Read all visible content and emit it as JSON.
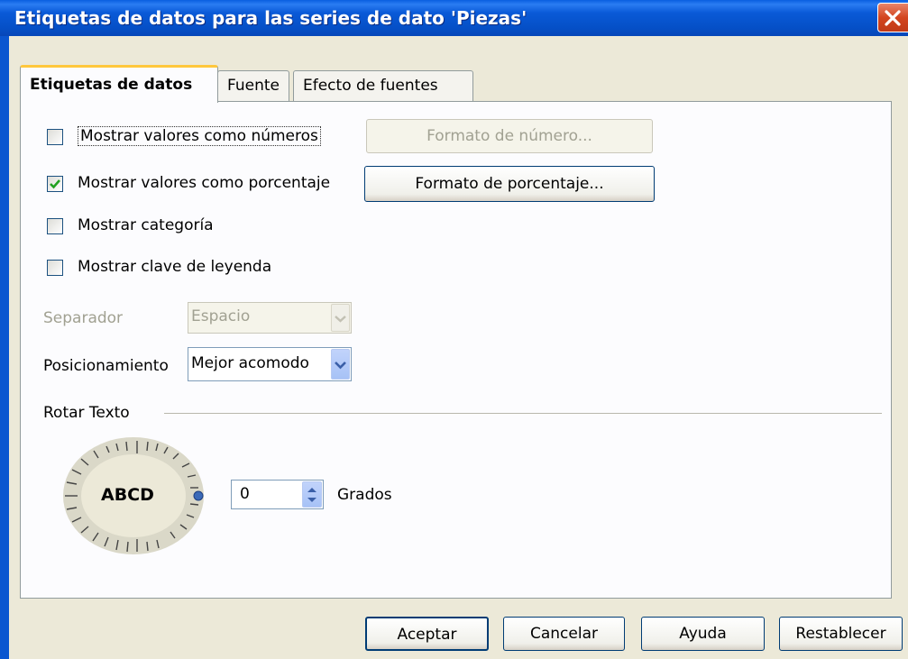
{
  "window": {
    "title": "Etiquetas de datos para las series de dato 'Piezas'",
    "close_icon": "close-icon"
  },
  "tabs": [
    {
      "label": "Etiquetas de datos",
      "active": true
    },
    {
      "label": "Fuente",
      "active": false
    },
    {
      "label": "Efecto de fuentes",
      "active": false
    }
  ],
  "options": {
    "show_numbers": {
      "label": "Mostrar valores como números",
      "checked": false
    },
    "show_percent": {
      "label": "Mostrar valores como porcentaje",
      "checked": true
    },
    "show_category": {
      "label": "Mostrar categoría",
      "checked": false
    },
    "show_legend_key": {
      "label": "Mostrar clave de leyenda",
      "checked": false
    }
  },
  "buttons": {
    "number_format": "Formato de número...",
    "percent_format": "Formato de porcentaje..."
  },
  "separator": {
    "label": "Separador",
    "value": "Espacio"
  },
  "placement": {
    "label": "Posicionamiento",
    "value": "Mejor acomodo"
  },
  "rotate": {
    "section_label": "Rotar Texto",
    "dial_text": "ABCD",
    "degrees_value": "0",
    "degrees_label": "Grados"
  },
  "footer": {
    "ok": "Aceptar",
    "cancel": "Cancelar",
    "help": "Ayuda",
    "reset": "Restablecer"
  },
  "colors": {
    "titlebar": "#0a5ad8",
    "dialog_bg": "#ece9d8",
    "panel_bg": "#fcfcfe",
    "check_mark": "#21a121",
    "active_tab_accent": "#ffc83c"
  }
}
